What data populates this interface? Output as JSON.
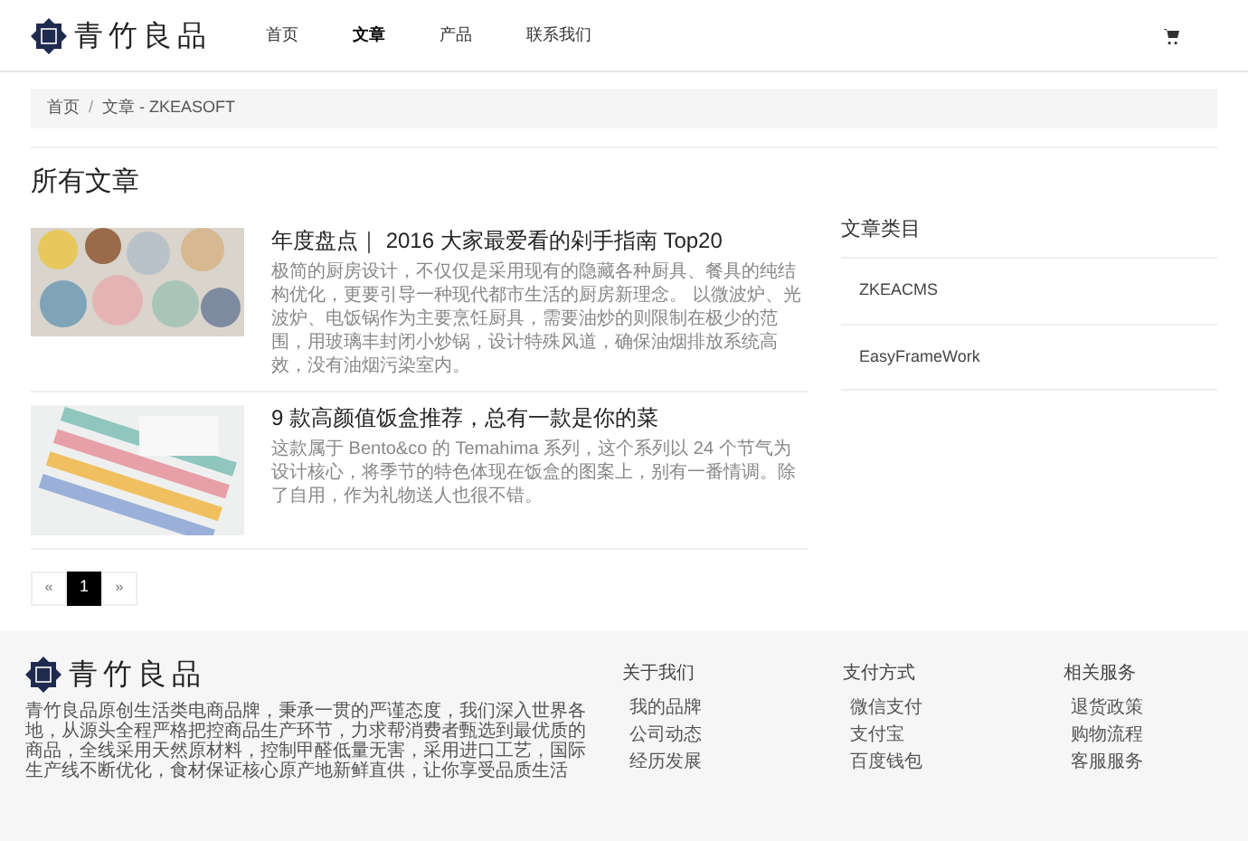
{
  "header": {
    "logo_text": "青竹良品",
    "nav": [
      {
        "label": "首页",
        "selected": false
      },
      {
        "label": "文章",
        "selected": true
      },
      {
        "label": "产品",
        "selected": false
      },
      {
        "label": "联系我们",
        "selected": false
      }
    ]
  },
  "breadcrumb": {
    "items": [
      "首页",
      "文章 - ZKEASOFT"
    ],
    "separator": "/"
  },
  "page_title": "所有文章",
  "articles": [
    {
      "title": "年度盘点｜ 2016 大家最爱看的剁手指南 Top20",
      "summary": "极简的厨房设计，不仅仅是采用现有的隐藏各种厨具、餐具的纯结构优化，更要引导一种现代都市生活的厨房新理念。 以微波炉、光波炉、电饭锅作为主要烹饪厨具，需要油炒的则限制在极少的范围，用玻璃丰封闭小炒锅，设计特殊风道，确保油烟排放系统高效，没有油烟污染室内。",
      "kind": "plates"
    },
    {
      "title": "9 款高颜值饭盒推荐，总有一款是你的菜",
      "summary": "这款属于 Bento&co 的 Temahima 系列，这个系列以 24 个节气为设计核心，将季节的特色体现在饭盒的图案上，别有一番情调。除了自用，作为礼物送人也很不错。",
      "kind": "boxes"
    }
  ],
  "sidebar": {
    "title": "文章类目",
    "items": [
      "ZKEACMS",
      "EasyFrameWork"
    ]
  },
  "pagination": [
    {
      "label": "«",
      "kind": "prev",
      "selected": false
    },
    {
      "label": "1",
      "kind": "page",
      "selected": true
    },
    {
      "label": "»",
      "kind": "next",
      "selected": false
    }
  ],
  "footer": {
    "logo_text": "青竹良品",
    "description": "青竹良品原创生活类电商品牌，秉承一贯的严谨态度，我们深入世界各地，从源头全程严格把控商品生产环节，力求帮消费者甄选到最优质的商品，全线采用天然原材料，控制甲醛低量无害，采用进口工艺，国际生产线不断优化，食材保证核心原产地新鲜直供，让你享受品质生活",
    "columns": [
      {
        "title": "关于我们",
        "links": [
          "我的品牌",
          "公司动态",
          "经历发展"
        ]
      },
      {
        "title": "支付方式",
        "links": [
          "微信支付",
          "支付宝",
          "百度钱包"
        ]
      },
      {
        "title": "相关服务",
        "links": [
          "退货政策",
          "购物流程",
          "客服服务"
        ]
      }
    ]
  }
}
